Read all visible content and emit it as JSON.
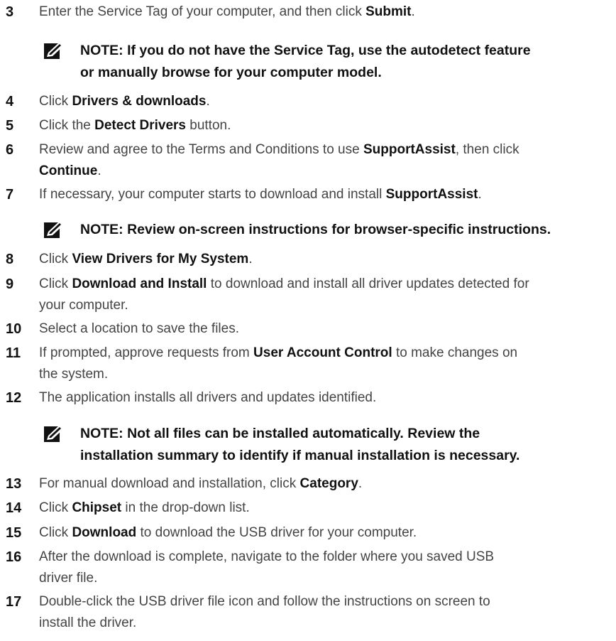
{
  "steps": [
    {
      "num": "3",
      "segments": [
        {
          "t": "Enter the Service Tag of your computer, and then click "
        },
        {
          "t": "Submit",
          "b": true
        },
        {
          "t": "."
        }
      ]
    },
    {
      "num": "4",
      "segments": [
        {
          "t": "Click "
        },
        {
          "t": "Drivers & downloads",
          "b": true
        },
        {
          "t": "."
        }
      ]
    },
    {
      "num": "5",
      "segments": [
        {
          "t": "Click the "
        },
        {
          "t": "Detect Drivers",
          "b": true
        },
        {
          "t": " button."
        }
      ]
    },
    {
      "num": "6",
      "segments": [
        {
          "t": "Review and agree to the Terms and Conditions to use "
        },
        {
          "t": "SupportAssist",
          "b": true
        },
        {
          "t": ", then click"
        },
        {
          "br": true
        },
        {
          "t": "Continue",
          "b": true
        },
        {
          "t": "."
        }
      ]
    },
    {
      "num": "7",
      "segments": [
        {
          "t": "If necessary, your computer starts to download and install "
        },
        {
          "t": "SupportAssist",
          "b": true
        },
        {
          "t": "."
        }
      ]
    },
    {
      "num": "8",
      "segments": [
        {
          "t": "Click "
        },
        {
          "t": "View Drivers for My System",
          "b": true
        },
        {
          "t": "."
        }
      ]
    },
    {
      "num": "9",
      "segments": [
        {
          "t": "Click "
        },
        {
          "t": "Download and Install",
          "b": true
        },
        {
          "t": " to download and install all driver updates detected for"
        },
        {
          "br": true
        },
        {
          "t": "your computer."
        }
      ]
    },
    {
      "num": "10",
      "segments": [
        {
          "t": "Select a location to save the files."
        }
      ]
    },
    {
      "num": "11",
      "segments": [
        {
          "t": "If prompted, approve requests from "
        },
        {
          "t": "User Account Control",
          "b": true
        },
        {
          "t": " to make changes on"
        },
        {
          "br": true
        },
        {
          "t": "the system."
        }
      ]
    },
    {
      "num": "12",
      "segments": [
        {
          "t": "The application installs all drivers and updates identified."
        }
      ]
    },
    {
      "num": "13",
      "segments": [
        {
          "t": "For manual download and installation, click "
        },
        {
          "t": "Category",
          "b": true
        },
        {
          "t": "."
        }
      ]
    },
    {
      "num": "14",
      "segments": [
        {
          "t": "Click "
        },
        {
          "t": "Chipset",
          "b": true
        },
        {
          "t": " in the drop-down list."
        }
      ]
    },
    {
      "num": "15",
      "segments": [
        {
          "t": "Click "
        },
        {
          "t": "Download",
          "b": true
        },
        {
          "t": " to download the USB driver for your computer."
        }
      ]
    },
    {
      "num": "16",
      "segments": [
        {
          "t": "After the download is complete, navigate to the folder where you saved USB"
        },
        {
          "br": true
        },
        {
          "t": "driver file."
        }
      ]
    },
    {
      "num": "17",
      "segments": [
        {
          "t": "Double-click the USB driver file icon and follow the instructions on screen to"
        },
        {
          "br": true
        },
        {
          "t": "install the driver."
        }
      ]
    }
  ],
  "notes": [
    {
      "text1": "NOTE: If you do not have the Service Tag, use the autodetect feature",
      "text2": "or manually browse for your computer model."
    },
    {
      "text1": "NOTE: Review on-screen instructions for browser-specific instructions.",
      "text2": ""
    },
    {
      "text1": "NOTE: Not all files can be installed automatically. Review the",
      "text2": "installation summary to identify if manual installation is necessary."
    }
  ],
  "note_icon": "pencil-note-icon"
}
